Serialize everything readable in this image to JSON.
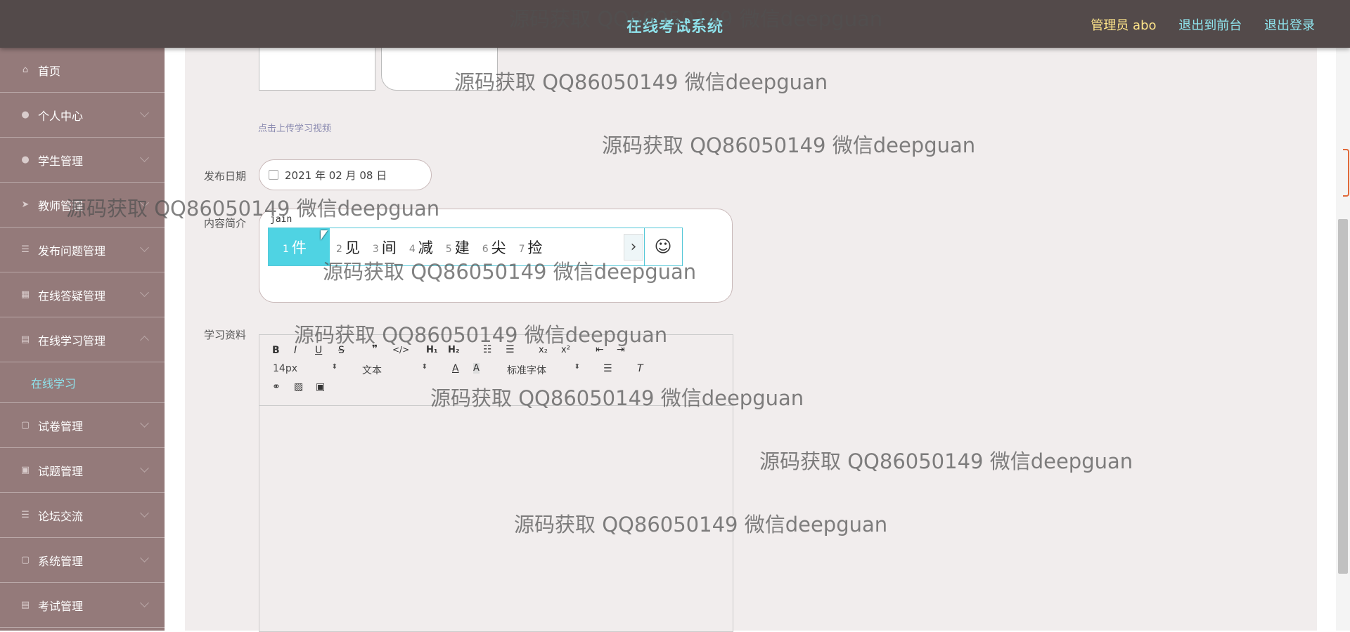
{
  "header": {
    "title": "在线考试系统",
    "admin": "管理员 abo",
    "to_front": "退出到前台",
    "logout": "退出登录"
  },
  "sidebar": {
    "items": [
      {
        "label": "首页",
        "icon": "home-icon"
      },
      {
        "label": "个人中心",
        "icon": "user-icon"
      },
      {
        "label": "学生管理",
        "icon": "student-icon"
      },
      {
        "label": "教师管理",
        "icon": "send-icon"
      },
      {
        "label": "发布问题管理",
        "icon": "list-icon"
      },
      {
        "label": "在线答疑管理",
        "icon": "grid-icon"
      },
      {
        "label": "在线学习管理",
        "icon": "clipboard-icon",
        "expanded": true
      },
      {
        "label": "试卷管理",
        "icon": "doc-icon"
      },
      {
        "label": "试题管理",
        "icon": "camera-icon"
      },
      {
        "label": "论坛交流",
        "icon": "forum-icon"
      },
      {
        "label": "系统管理",
        "icon": "settings-icon"
      },
      {
        "label": "考试管理",
        "icon": "exam-icon"
      }
    ],
    "sub_item": "在线学习"
  },
  "form": {
    "upload_hint": "点击上传学习视频",
    "date_label": "发布日期",
    "date_value": "2021 年 02 月 08 日",
    "intro_label": "内容简介",
    "intro_typed": "jain",
    "material_label": "学习资料"
  },
  "ime": {
    "candidates": [
      {
        "num": "1",
        "char": "件"
      },
      {
        "num": "2",
        "char": "见"
      },
      {
        "num": "3",
        "char": "间"
      },
      {
        "num": "4",
        "char": "减"
      },
      {
        "num": "5",
        "char": "建"
      },
      {
        "num": "6",
        "char": "尖"
      },
      {
        "num": "7",
        "char": "捡"
      }
    ],
    "next": "›",
    "emoji": "☺"
  },
  "editor": {
    "font_size": "14px",
    "block_type": "文本",
    "font_family": "标准字体"
  },
  "watermark": "源码获取 QQ86050149 微信deepguan",
  "colors": {
    "topbar": "#534a4a",
    "sidebar": "#947a7a",
    "accent": "#8fe3ec",
    "admin": "#ffe58a",
    "content_bg": "#f1eded"
  }
}
